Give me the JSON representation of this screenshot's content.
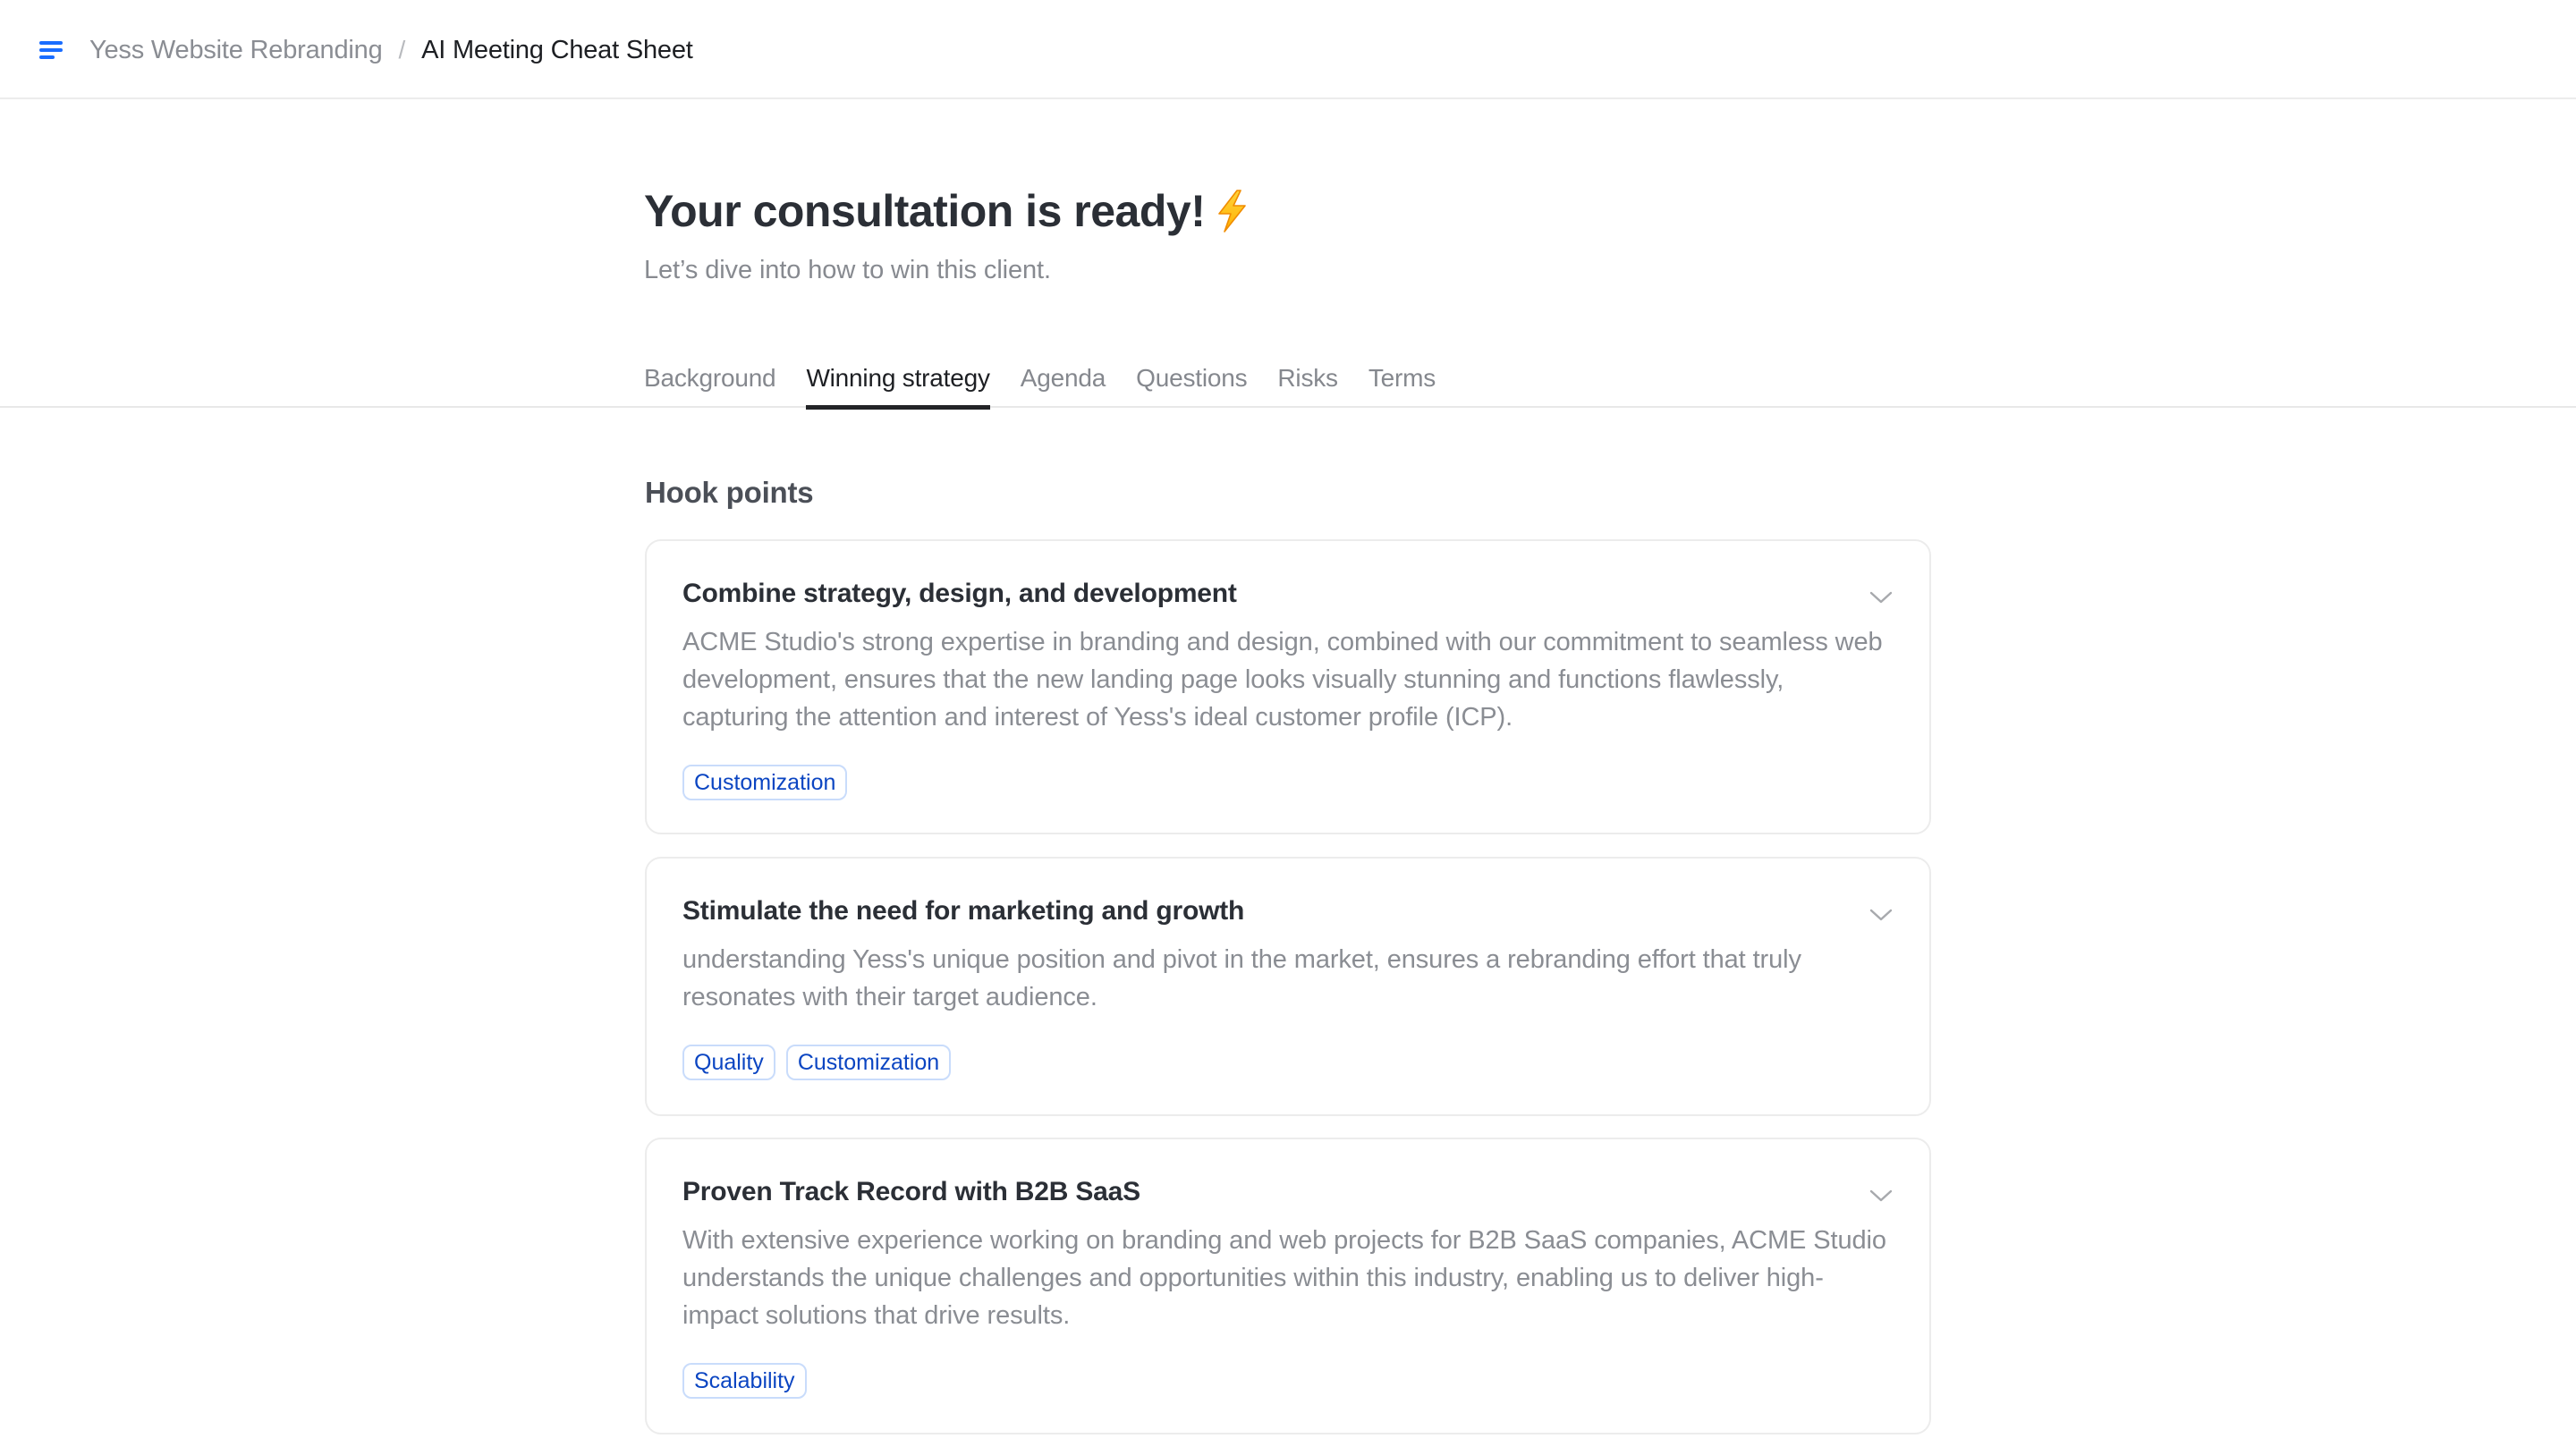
{
  "topbar": {
    "menu_icon": "menu-icon",
    "breadcrumb": {
      "parent": "Yess Website Rebranding",
      "separator": "/",
      "current": "AI Meeting Cheat Sheet"
    }
  },
  "hero": {
    "title": "Your consultation is ready!",
    "title_icon": "lightning-bolt-icon",
    "subtitle": "Let’s dive into how to win this client."
  },
  "tabs": [
    {
      "label": "Background",
      "active": false
    },
    {
      "label": "Winning strategy",
      "active": true
    },
    {
      "label": "Agenda",
      "active": false
    },
    {
      "label": "Questions",
      "active": false
    },
    {
      "label": "Risks",
      "active": false
    },
    {
      "label": "Terms",
      "active": false
    }
  ],
  "section": {
    "heading": "Hook points",
    "cards": [
      {
        "title": "Combine strategy, design, and development",
        "body": "ACME Studio's strong expertise in branding and design, combined with our commitment to seamless web development, ensures that the new landing page looks visually stunning and functions flawlessly, capturing the attention and interest of Yess's ideal customer profile (ICP).",
        "tags": [
          "Customization"
        ]
      },
      {
        "title": "Stimulate the need for marketing and growth",
        "body": "understanding Yess's unique position and pivot in the market, ensures a rebranding effort that truly resonates with their target audience.",
        "tags": [
          "Quality",
          "Customization"
        ]
      },
      {
        "title": "Proven Track Record with B2B SaaS",
        "body": "With extensive experience working on branding and web projects for B2B SaaS companies, ACME Studio understands the unique challenges and opportunities within this industry, enabling us to deliver high-impact solutions that drive results.",
        "tags": [
          "Scalability"
        ]
      }
    ]
  },
  "colors": {
    "accent": "#1a6dff",
    "tag_text": "#0b45c2",
    "tag_border": "#c9dcfb",
    "title_text": "#2b2f36",
    "muted_text": "#8a8d93",
    "active_tab_underline": "#232427"
  }
}
